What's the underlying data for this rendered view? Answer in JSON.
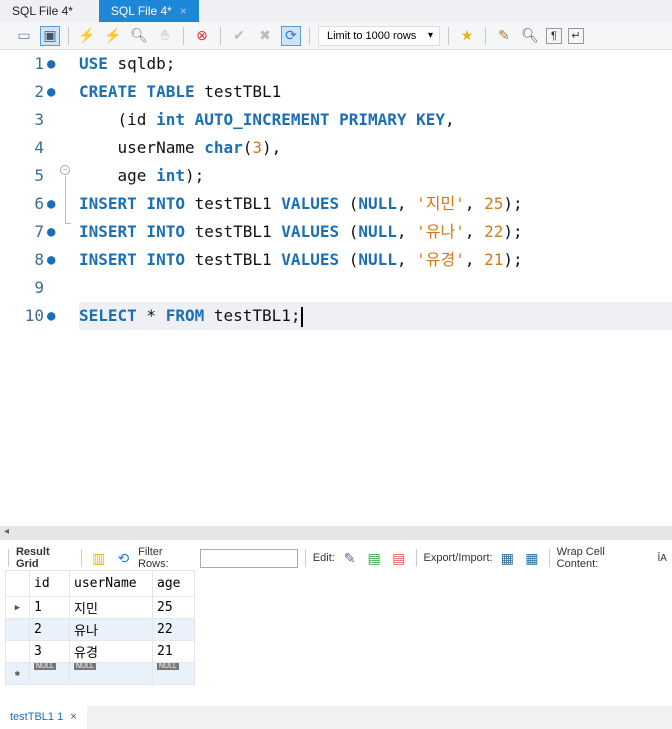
{
  "tabs": [
    {
      "label": "SQL File 4*"
    },
    {
      "label": "SQL File 4*",
      "close": "×"
    }
  ],
  "toolbar": {
    "limit": "Limit to 1000 rows"
  },
  "editor": {
    "lines": [
      [
        {
          "t": "USE",
          "c": "kw"
        },
        {
          "t": " sqldb;"
        }
      ],
      [
        {
          "t": "CREATE TABLE",
          "c": "kw"
        },
        {
          "t": " testTBL1"
        }
      ],
      [
        {
          "t": "    (id "
        },
        {
          "t": "int AUTO_INCREMENT PRIMARY KEY",
          "c": "kw"
        },
        {
          "t": ","
        }
      ],
      [
        {
          "t": "    userName "
        },
        {
          "t": "char",
          "c": "kw"
        },
        {
          "t": "("
        },
        {
          "t": "3",
          "c": "num"
        },
        {
          "t": "),"
        }
      ],
      [
        {
          "t": "    age "
        },
        {
          "t": "int",
          "c": "kw"
        },
        {
          "t": ");"
        }
      ],
      [
        {
          "t": "INSERT INTO",
          "c": "kw"
        },
        {
          "t": " testTBL1 "
        },
        {
          "t": "VALUES",
          "c": "kw"
        },
        {
          "t": " ("
        },
        {
          "t": "NULL",
          "c": "kw"
        },
        {
          "t": ", "
        },
        {
          "t": "'지민'",
          "c": "str"
        },
        {
          "t": ", "
        },
        {
          "t": "25",
          "c": "num"
        },
        {
          "t": ");"
        }
      ],
      [
        {
          "t": "INSERT INTO",
          "c": "kw"
        },
        {
          "t": " testTBL1 "
        },
        {
          "t": "VALUES",
          "c": "kw"
        },
        {
          "t": " ("
        },
        {
          "t": "NULL",
          "c": "kw"
        },
        {
          "t": ", "
        },
        {
          "t": "'유나'",
          "c": "str"
        },
        {
          "t": ", "
        },
        {
          "t": "22",
          "c": "num"
        },
        {
          "t": ");"
        }
      ],
      [
        {
          "t": "INSERT INTO",
          "c": "kw"
        },
        {
          "t": " testTBL1 "
        },
        {
          "t": "VALUES",
          "c": "kw"
        },
        {
          "t": " ("
        },
        {
          "t": "NULL",
          "c": "kw"
        },
        {
          "t": ", "
        },
        {
          "t": "'유경'",
          "c": "str"
        },
        {
          "t": ", "
        },
        {
          "t": "21",
          "c": "num"
        },
        {
          "t": ");"
        }
      ],
      [],
      [
        {
          "t": "SELECT",
          "c": "kw"
        },
        {
          "t": " * "
        },
        {
          "t": "FROM",
          "c": "kw"
        },
        {
          "t": " testTBL1;"
        }
      ]
    ],
    "line_numbers": [
      "1",
      "2",
      "3",
      "4",
      "5",
      "6",
      "7",
      "8",
      "9",
      "10"
    ],
    "statement_lines": [
      1,
      2,
      6,
      7,
      8,
      10
    ]
  },
  "result": {
    "result_grid": "Result Grid",
    "filter_label": "Filter Rows:",
    "edit_label": "Edit:",
    "export_label": "Export/Import:",
    "wrap_label": "Wrap Cell Content:",
    "columns": [
      "id",
      "userName",
      "age"
    ],
    "rows": [
      [
        "1",
        "지민",
        "25"
      ],
      [
        "2",
        "유나",
        "22"
      ],
      [
        "3",
        "유경",
        "21"
      ]
    ],
    "null_label": "NULL"
  },
  "bottom_tab": {
    "label": "testTBL1 1",
    "close": "×"
  }
}
